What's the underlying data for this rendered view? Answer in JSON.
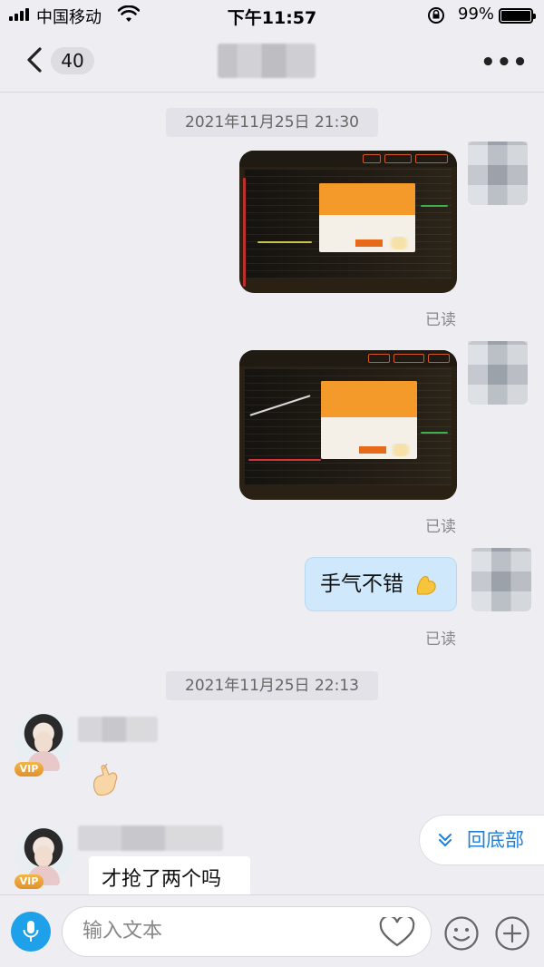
{
  "status_bar": {
    "carrier": "中国移动",
    "time": "下午11:57",
    "battery": "99%"
  },
  "nav": {
    "unread_count": "40",
    "more": "•••"
  },
  "messages": {
    "timestamp1": "2021年11月25日 21:30",
    "read_label": "已读",
    "sent_text": "手气不错",
    "timestamp2": "2021年11月25日 22:13",
    "received_text": "才抢了两个吗",
    "vip": "VIP"
  },
  "back_to_bottom": "回底部",
  "input": {
    "placeholder": "输入文本"
  },
  "colors": {
    "accent": "#1ea1e8",
    "sent_bubble": "#cfe8fb",
    "link_blue": "#1e7ed8"
  }
}
